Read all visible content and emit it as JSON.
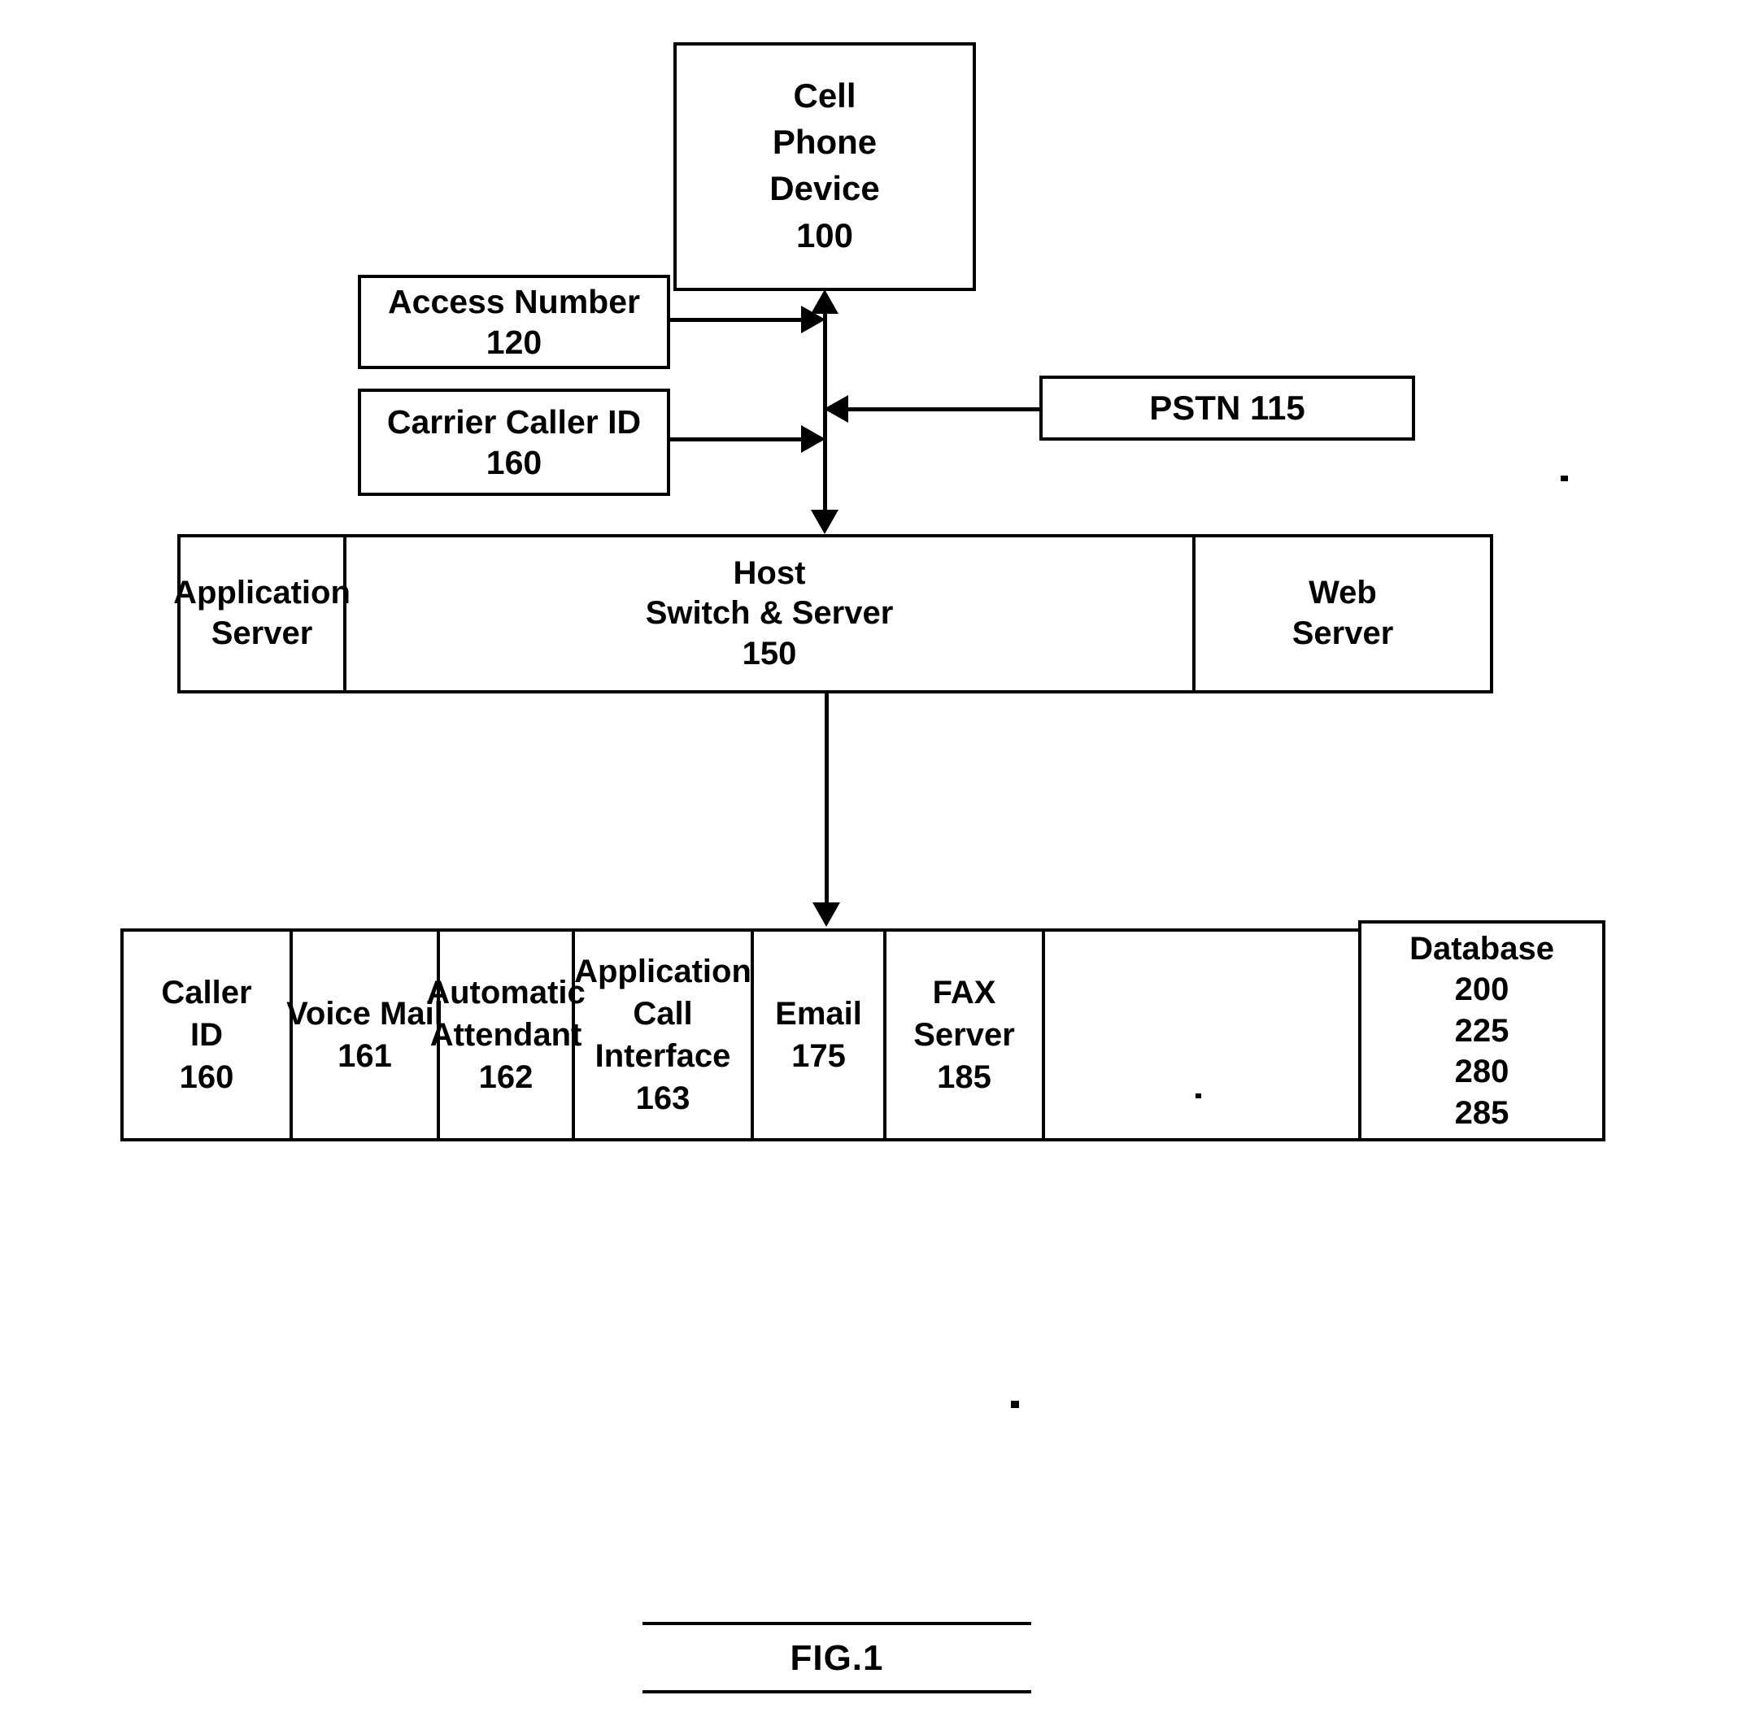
{
  "figure": {
    "caption": "FIG.1",
    "type": "patent-block-diagram"
  },
  "nodes": {
    "cell_phone_device": {
      "lines": [
        "Cell",
        "Phone",
        "Device",
        "100"
      ],
      "label": "Cell Phone Device",
      "ref": "100"
    },
    "access_number": {
      "lines": [
        "Access Number",
        "120"
      ],
      "label": "Access Number",
      "ref": "120"
    },
    "carrier_caller_id": {
      "lines": [
        "Carrier Caller ID",
        "160"
      ],
      "label": "Carrier Caller ID",
      "ref": "160"
    },
    "pstn": {
      "lines": [
        "PSTN 115"
      ],
      "label": "PSTN",
      "ref": "115"
    }
  },
  "host_row": {
    "cells": [
      {
        "lines": [
          "Application",
          "Server"
        ],
        "label": "Application Server",
        "ref": ""
      },
      {
        "lines": [
          "Host",
          "Switch & Server",
          "150"
        ],
        "label": "Host Switch & Server",
        "ref": "150"
      },
      {
        "lines": [
          "Web",
          "Server"
        ],
        "label": "Web Server",
        "ref": ""
      }
    ]
  },
  "services_row": {
    "cells": [
      {
        "lines": [
          "Caller",
          "ID",
          "160"
        ],
        "label": "Caller ID",
        "ref": "160"
      },
      {
        "lines": [
          "Voice Mail",
          "161"
        ],
        "label": "Voice Mail",
        "ref": "161"
      },
      {
        "lines": [
          "Automatic",
          "Attendant",
          "162"
        ],
        "label": "Automatic Attendant",
        "ref": "162"
      },
      {
        "lines": [
          "Application",
          "Call",
          "Interface",
          "163"
        ],
        "label": "Application Call Interface",
        "ref": "163"
      },
      {
        "lines": [
          "Email",
          "175"
        ],
        "label": "Email",
        "ref": "175"
      },
      {
        "lines": [
          "FAX",
          "Server",
          "185"
        ],
        "label": "FAX Server",
        "ref": "185"
      },
      {
        "lines": [
          "Database",
          "200",
          "225",
          "280",
          "285"
        ],
        "label": "Database",
        "ref": "200 225 280 285"
      }
    ]
  },
  "connectors": [
    {
      "from": "cell_phone_device",
      "to": "host_switch_server",
      "style": "double-headed-vertical"
    },
    {
      "from": "access_number",
      "to": "trunk",
      "style": "single-arrow-right"
    },
    {
      "from": "carrier_caller_id",
      "to": "trunk",
      "style": "single-arrow-right"
    },
    {
      "from": "pstn",
      "to": "trunk",
      "style": "single-arrow-left"
    },
    {
      "from": "host_switch_server",
      "to": "services_row",
      "style": "single-arrow-down"
    }
  ]
}
